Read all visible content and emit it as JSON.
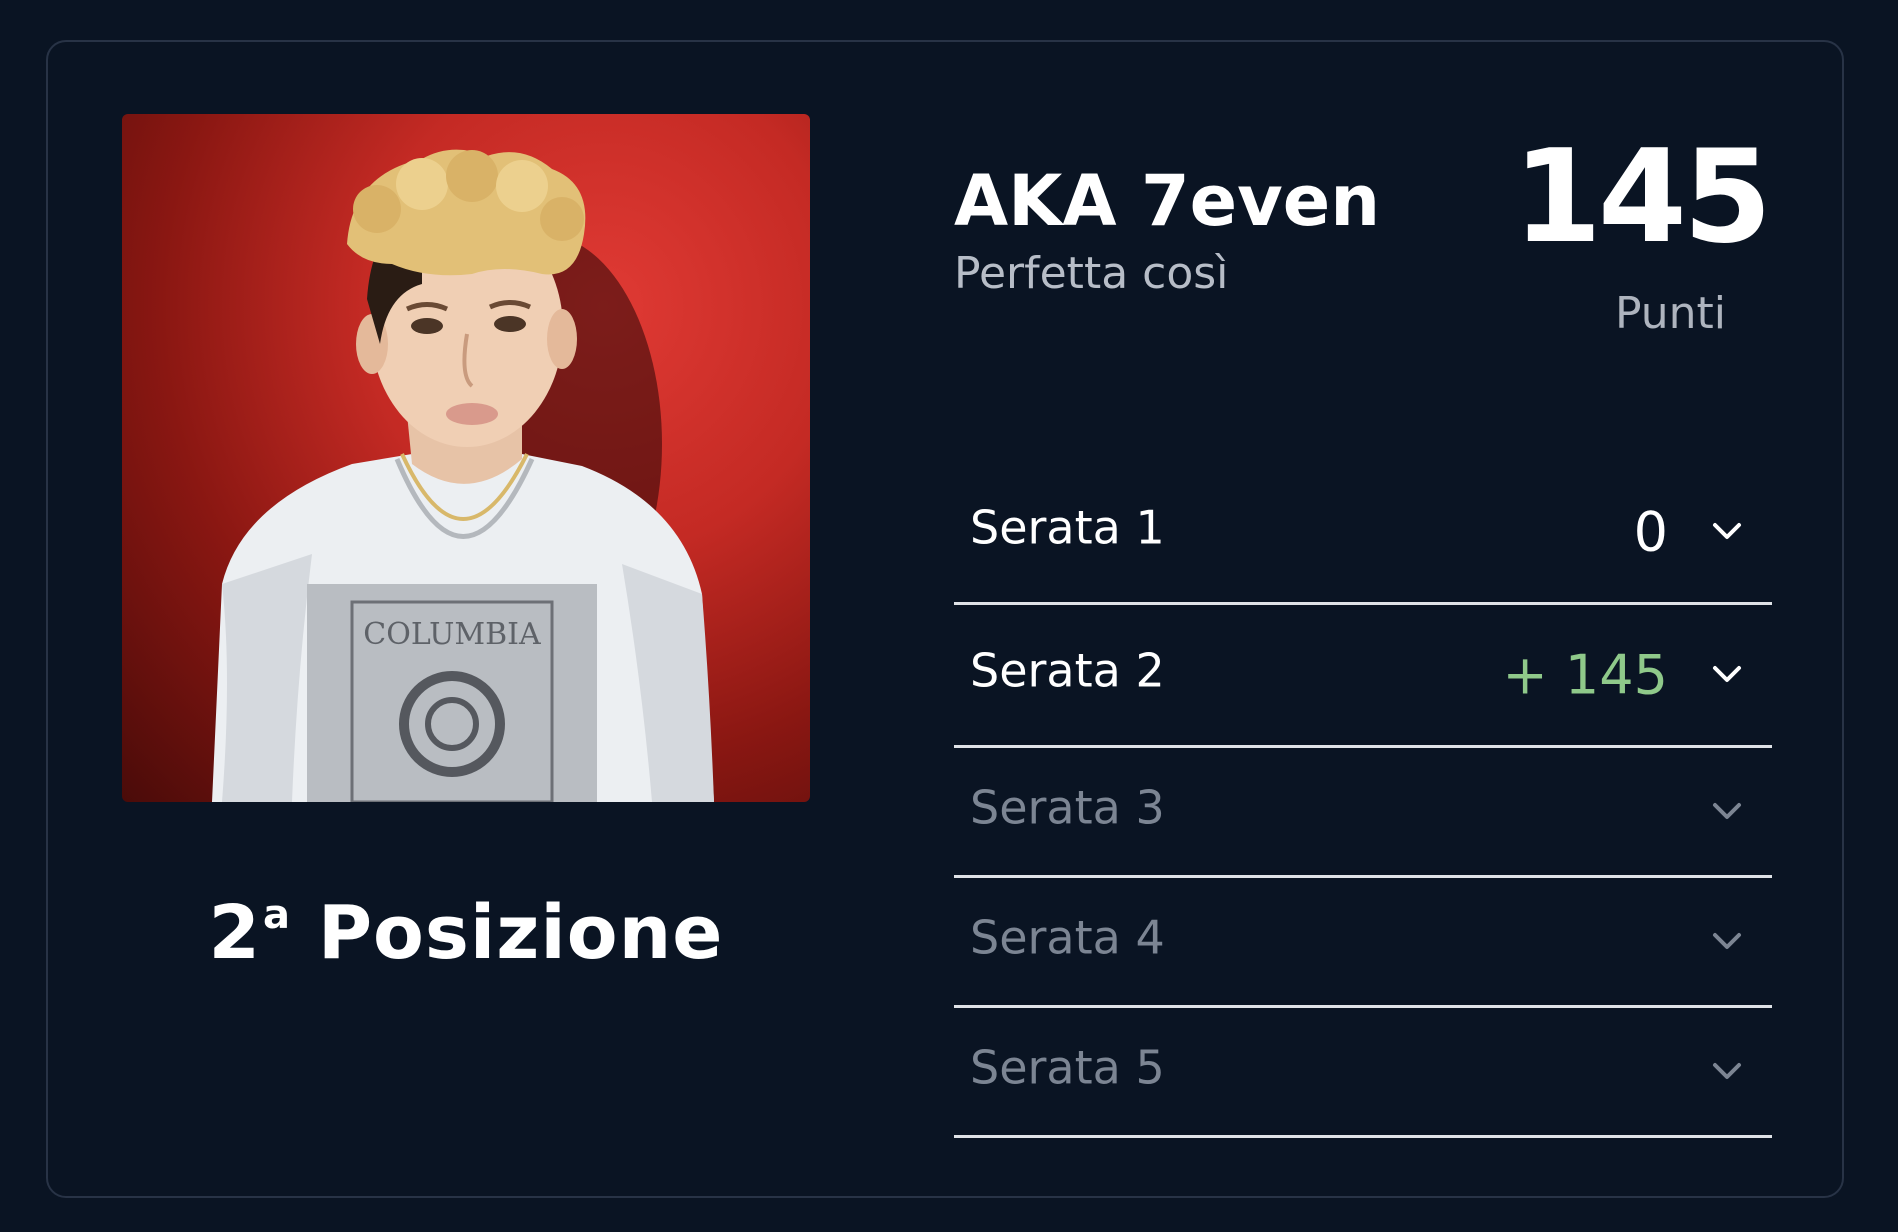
{
  "artist": {
    "name": "AKA 7even",
    "song": "Perfetta così",
    "photo_alt": "Foto di AKA 7even"
  },
  "ranking": {
    "rank_number": "2",
    "rank_suffix": "a",
    "rank_word": "Posizione"
  },
  "score": {
    "value": "145",
    "label": "Punti"
  },
  "nights": [
    {
      "label": "Serata 1",
      "points": "0",
      "state": "scored",
      "color": "#ffffff"
    },
    {
      "label": "Serata 2",
      "points": "+ 145",
      "state": "scored",
      "color": "#8fc98a"
    },
    {
      "label": "Serata 3",
      "points": "",
      "state": "disabled"
    },
    {
      "label": "Serata 4",
      "points": "",
      "state": "disabled"
    },
    {
      "label": "Serata 5",
      "points": "",
      "state": "disabled"
    }
  ],
  "icons": {
    "expand": "chevron-down-icon"
  },
  "colors": {
    "background": "#0a1423",
    "card_border": "#283346",
    "positive_points": "#8fc98a",
    "disabled_text": "#7c8593"
  }
}
